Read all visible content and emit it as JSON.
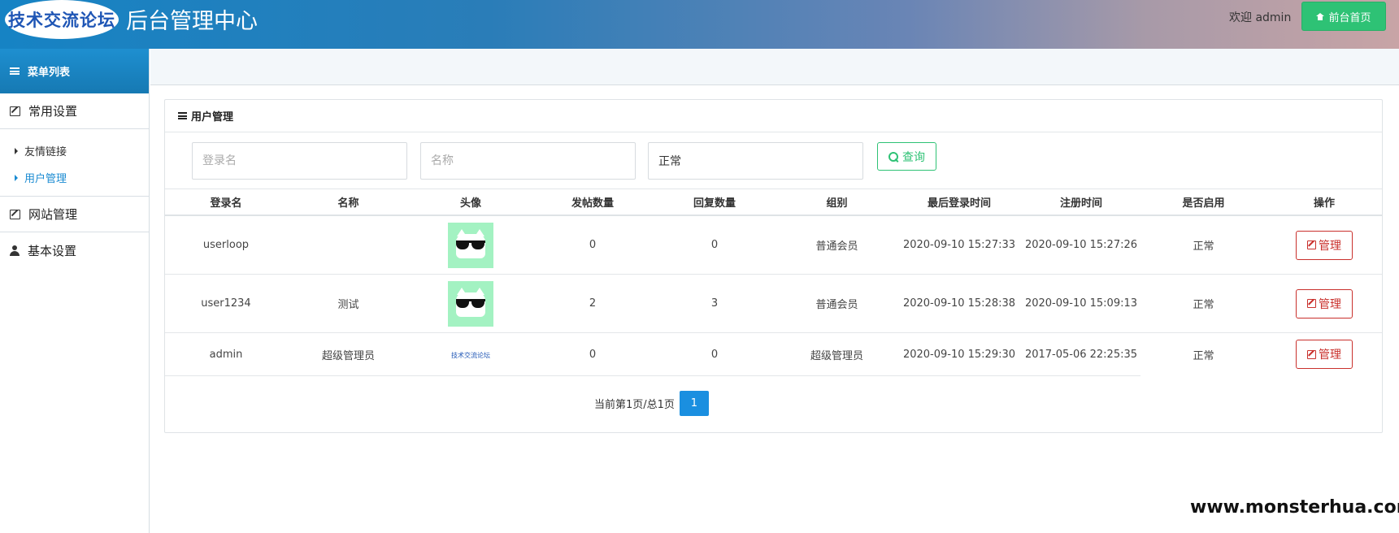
{
  "header": {
    "logo_text": "技术交流论坛",
    "title": "后台管理中心",
    "welcome": "欢迎 admin",
    "home_button": "前台首页"
  },
  "sidebar": {
    "menu_title": "菜单列表",
    "groups": [
      {
        "label": "常用设置",
        "icon": "edit-icon"
      },
      {
        "label": "网站管理",
        "icon": "edit-icon"
      },
      {
        "label": "基本设置",
        "icon": "user-icon"
      }
    ],
    "sub_items": [
      {
        "label": "友情链接",
        "active": false
      },
      {
        "label": "用户管理",
        "active": true
      }
    ]
  },
  "panel": {
    "title": "用户管理"
  },
  "search": {
    "login_placeholder": "登录名",
    "name_placeholder": "名称",
    "status_value": "正常",
    "button": "查询"
  },
  "table": {
    "headers": [
      "登录名",
      "名称",
      "头像",
      "发帖数量",
      "回复数量",
      "组别",
      "最后登录时间",
      "注册时间",
      "是否启用",
      "操作"
    ],
    "rows": [
      {
        "login": "userloop",
        "name": "",
        "avatar": "cat-sunglasses",
        "posts": "0",
        "replies": "0",
        "group": "普通会员",
        "last_login": "2020-09-10 15:27:33",
        "registered": "2020-09-10 15:27:26",
        "enabled": "正常",
        "action": "管理"
      },
      {
        "login": "user1234",
        "name": "测试",
        "avatar": "cat-sunglasses",
        "posts": "2",
        "replies": "3",
        "group": "普通会员",
        "last_login": "2020-09-10 15:28:38",
        "registered": "2020-09-10 15:09:13",
        "enabled": "正常",
        "action": "管理"
      },
      {
        "login": "admin",
        "name": "超级管理员",
        "avatar": "site-logo",
        "avatar_text": "技术交流论坛",
        "posts": "0",
        "replies": "0",
        "group": "超级管理员",
        "last_login": "2020-09-10 15:29:30",
        "registered": "2017-05-06 22:25:35",
        "enabled": "正常",
        "action": "管理"
      }
    ]
  },
  "pager": {
    "info": "当前第1页/总1页",
    "current_page": "1"
  },
  "watermark": "www.monsterhua.com",
  "colors": {
    "accent": "#1a8bd2",
    "success": "#2ec275",
    "danger": "#c9302c"
  }
}
